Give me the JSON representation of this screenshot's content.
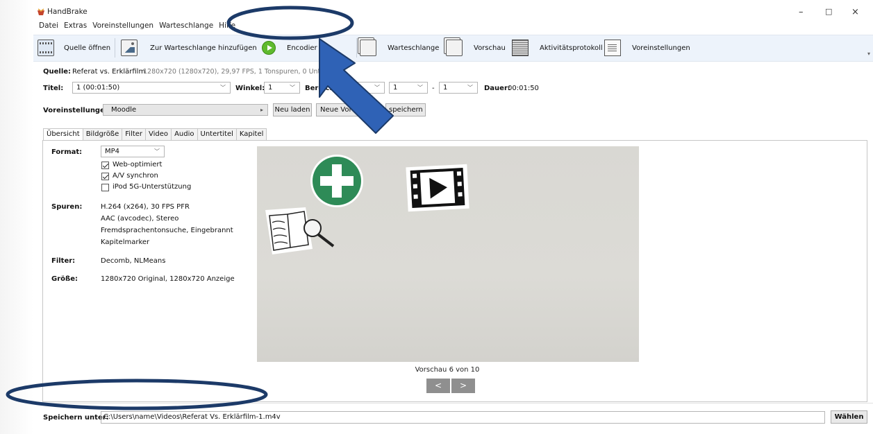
{
  "window": {
    "title": "HandBrake",
    "controls": [
      "–",
      "□",
      "×"
    ]
  },
  "menu": [
    "Datei",
    "Extras",
    "Voreinstellungen",
    "Warteschlange",
    "Hilfe"
  ],
  "toolbar": {
    "open_source": "Quelle öffnen",
    "add_queue": "Zur Warteschlange hinzufügen",
    "add_queue_arrow": "▾",
    "encode": "Encodier",
    "queue": "Warteschlange",
    "preview": "Vorschau",
    "activity_log": "Aktivitätsprotokoll",
    "presets": "Voreinstellungen"
  },
  "source": {
    "label": "Quelle:",
    "name": "Referat vs. Erklärfilm",
    "info": "1280x720 (1280x720), 29,97 FPS, 1 Tonspuren, 0 Untert"
  },
  "title_row": {
    "title_label": "Titel:",
    "title_value": "1 (00:01:50)",
    "angle_label": "Winkel:",
    "angle_value": "1",
    "range_label": "Bereich:",
    "range_start": "1",
    "range_sep": "-",
    "range_end": "1",
    "duration_label": "Dauer:",
    "duration_value": "00:01:50"
  },
  "presets_row": {
    "label": "Voreinstellungen",
    "value": "Moodle",
    "reload": "Neu laden",
    "new_preset": "Neue Vore",
    "save": "speichern"
  },
  "tabs": [
    "Übersicht",
    "Bildgröße",
    "Filter",
    "Video",
    "Audio",
    "Untertitel",
    "Kapitel"
  ],
  "summary": {
    "format_label": "Format:",
    "format_value": "MP4",
    "checks": [
      {
        "label": "Web-optimiert",
        "checked": true
      },
      {
        "label": "A/V synchron",
        "checked": true
      },
      {
        "label": "iPod 5G-Unterstützung",
        "checked": false
      }
    ],
    "tracks_label": "Spuren:",
    "tracks": [
      "H.264 (x264), 30 FPS PFR",
      "AAC (avcodec), Stereo",
      "Fremdsprachentonsuche, Eingebrannt",
      "Kapitelmarker"
    ],
    "filter_label": "Filter:",
    "filter_value": "Decomb, NLMeans",
    "size_label": "Größe:",
    "size_value": "1280x720 Original, 1280x720 Anzeige"
  },
  "preview": {
    "caption": "Vorschau 6 von 10",
    "prev": "<",
    "next": ">"
  },
  "save": {
    "label": "Speichern unter:",
    "path": "C:\\Users\\name\\Videos\\Referat Vs. Erklärfilm-1.m4v",
    "browse": "Wählen"
  },
  "annotation_colors": {
    "ellipse": "#1c3a68",
    "arrow_fill": "#2f62b6",
    "arrow_stroke": "#1c3a68"
  },
  "icons": [
    "film-icon",
    "add-queue-icon",
    "play-icon",
    "queue-icon",
    "preview-icon",
    "log-icon",
    "presets-icon"
  ]
}
